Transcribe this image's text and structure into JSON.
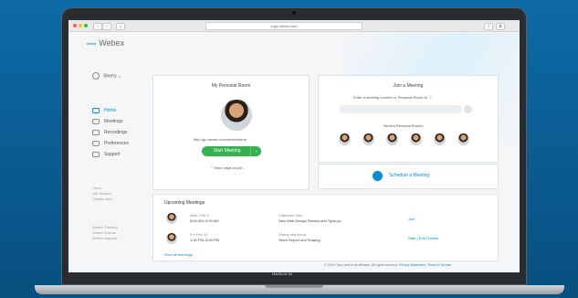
{
  "browser": {
    "url": "a.go.webex.com"
  },
  "app": {
    "logo_brand": "cisco",
    "logo_text": "Webex",
    "user_name": "Sherry"
  },
  "nav": {
    "items": [
      {
        "label": "Home",
        "active": true
      },
      {
        "label": "Meetings"
      },
      {
        "label": "Recordings"
      },
      {
        "label": "Preferences"
      },
      {
        "label": "Support"
      }
    ]
  },
  "side_links_1": [
    "Cisco",
    "Get Started",
    "Classic view"
  ],
  "side_links_2": [
    "Webex Training",
    "Webex Events",
    "Webex Support"
  ],
  "personal_room": {
    "title": "My Personal Room",
    "link": "http://go.webex.com/meet/sherry",
    "start_label": "Start Meeting",
    "more_ways": "More ways to join"
  },
  "join": {
    "title": "Join a Meeting",
    "prompt": "Enter a meeting number or Personal Room ID",
    "recent_label": "Recent Personal Rooms"
  },
  "schedule": {
    "label": "Schedule a Meeting"
  },
  "upcoming": {
    "title": "Upcoming Meetings",
    "meetings": [
      {
        "date": "Wed, Feb 9",
        "time": "8:00 AM–9:00 AM",
        "host": "Catherine Sinu",
        "title": "New Web Design Review and Sync-up",
        "actions": [
          "Join"
        ]
      },
      {
        "date": "Fri, Feb 10",
        "time": "1:30 PM–3:00 PM",
        "host": "Sherry McKenna",
        "title": "Team Report and Sharing",
        "actions": [
          "Start",
          "Edit",
          "Delete"
        ]
      }
    ],
    "view_all": "View all meetings"
  },
  "footer": {
    "text": "© 2016 Cisco and/or its affiliates. All rights reserved.",
    "privacy": "Privacy Statement",
    "terms": "Terms of Service"
  },
  "device_label": "MacBook Air",
  "colors": {
    "accent": "#0b8bd6",
    "start_green": "#35b150",
    "background": "#0b5f96"
  }
}
